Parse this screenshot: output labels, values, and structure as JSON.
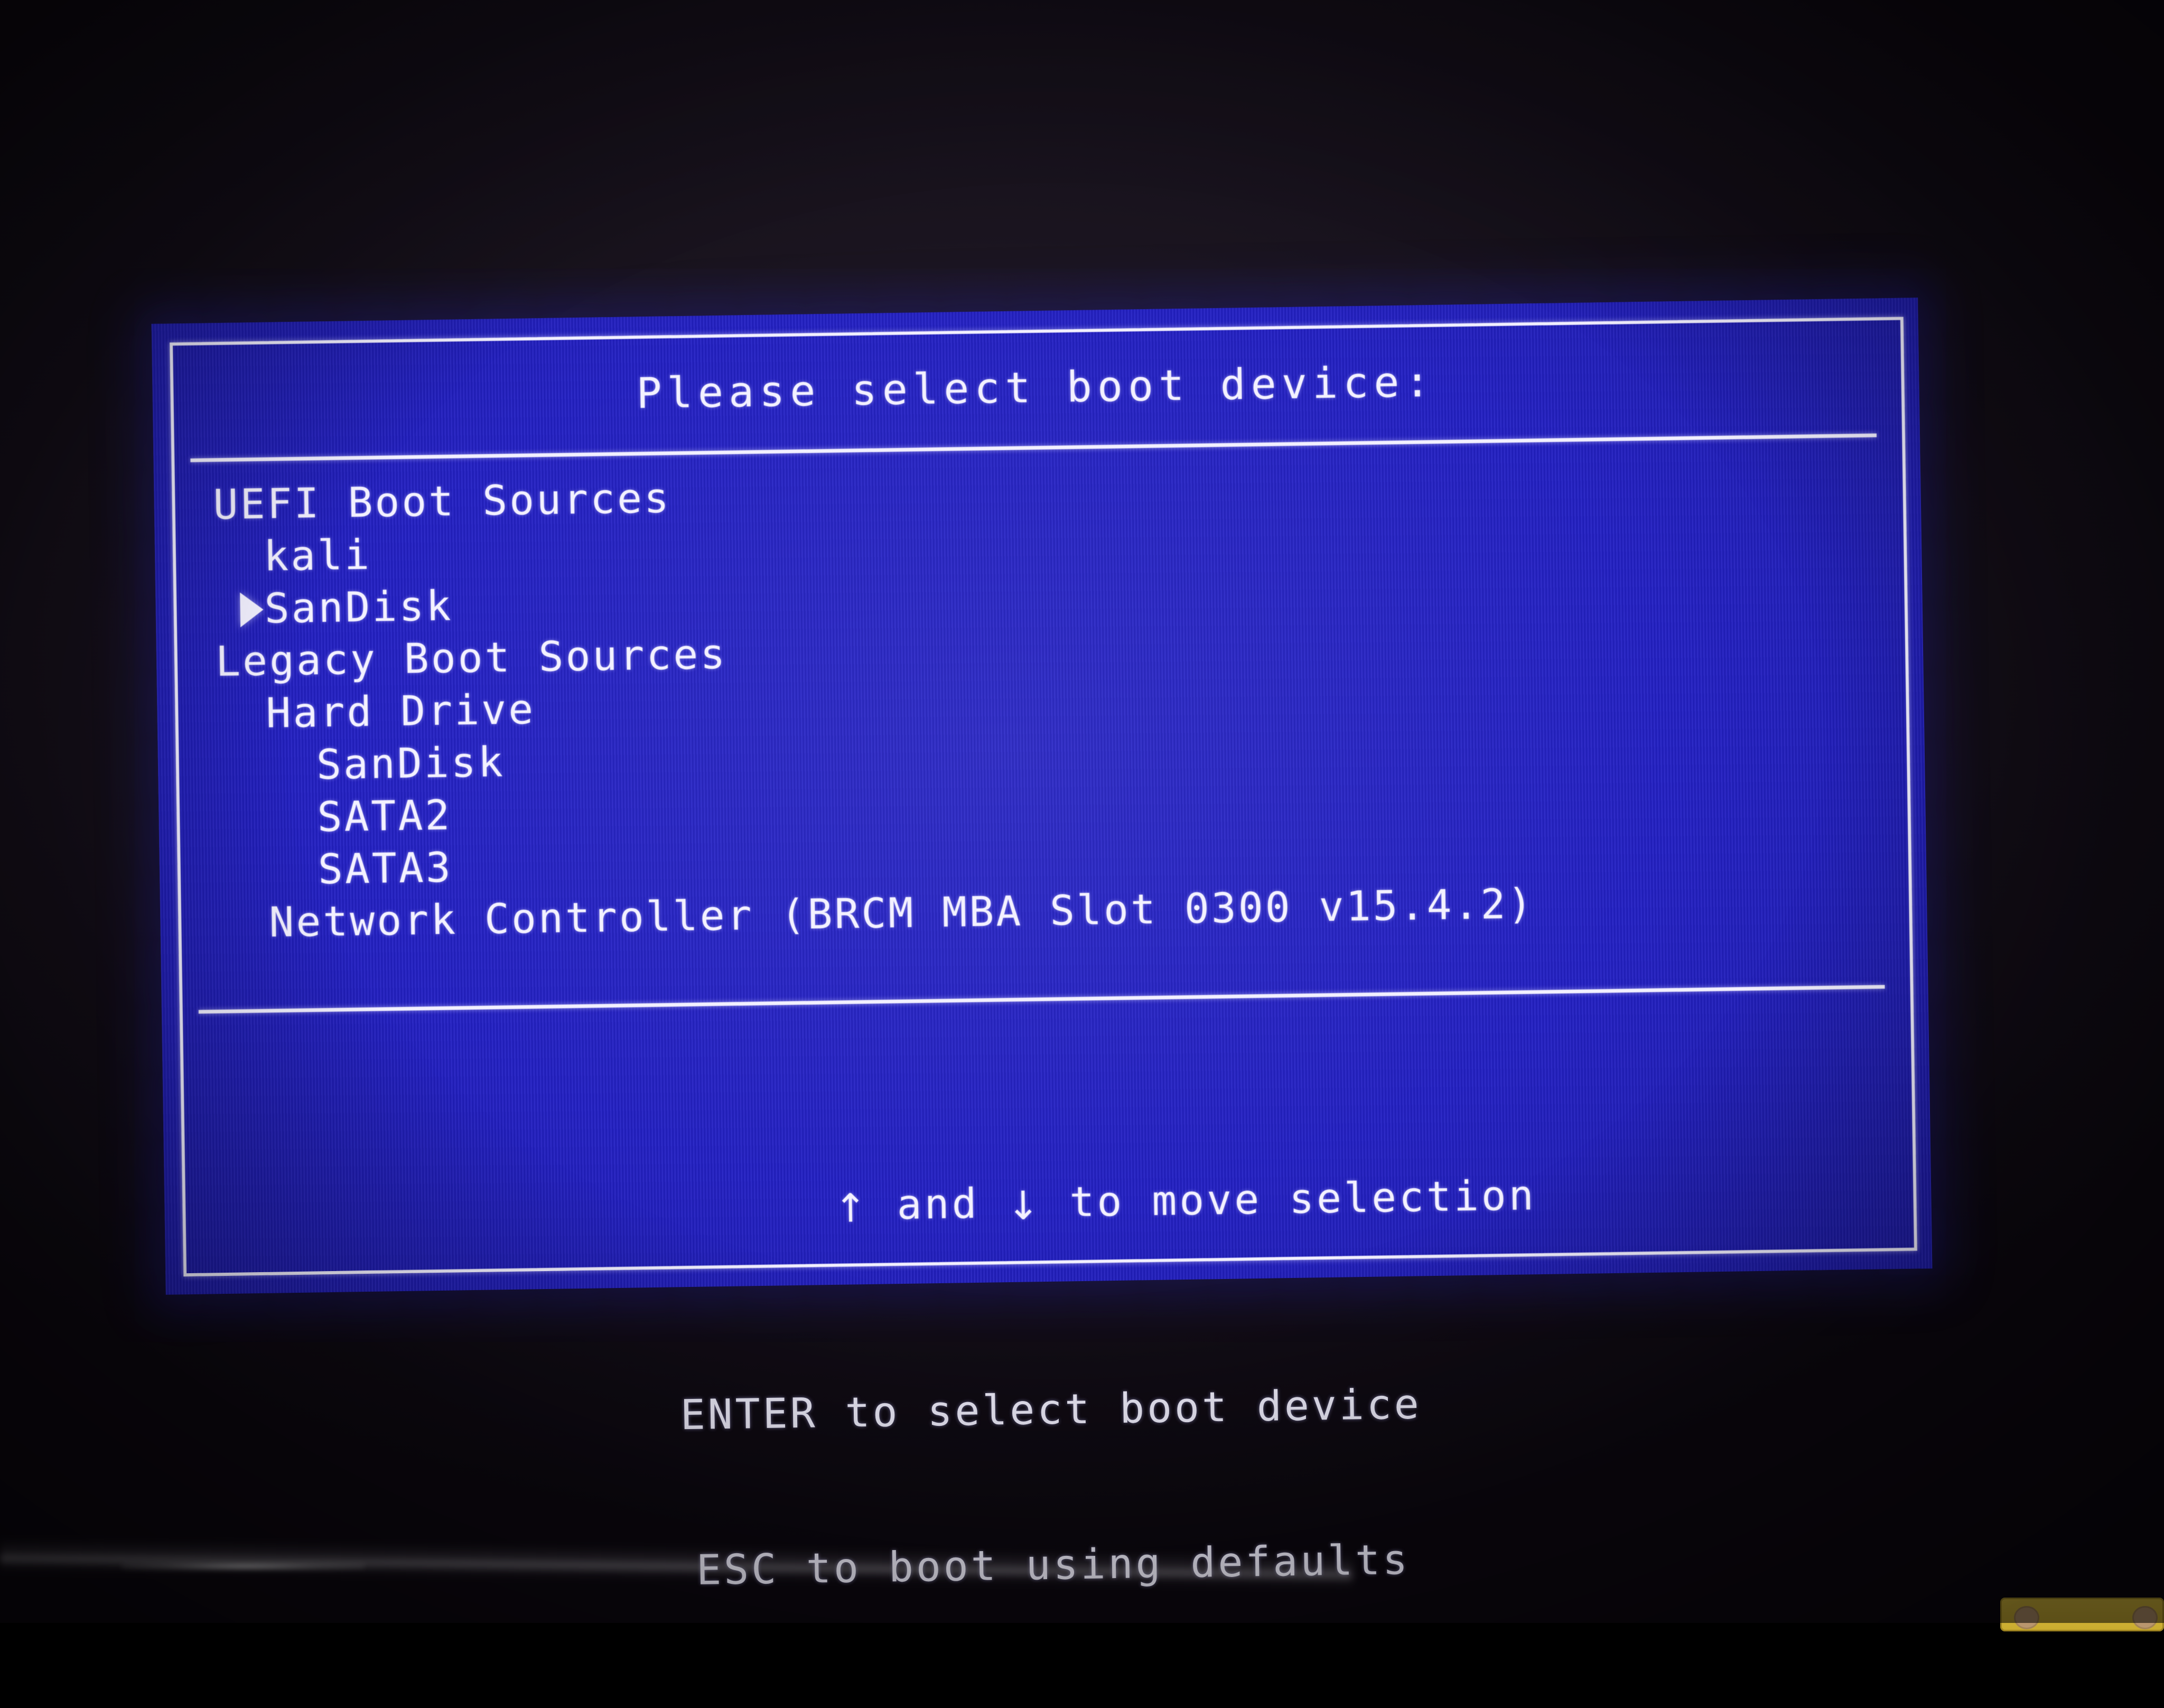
{
  "screen": {
    "background_color": "#2320c6",
    "text_color": "#f3f1ff",
    "title": "Please select boot device:"
  },
  "boot_list": [
    {
      "label": "UEFI Boot Sources",
      "indent": 0,
      "selected": false
    },
    {
      "label": "kali",
      "indent": 1,
      "selected": false
    },
    {
      "label": "SanDisk",
      "indent": 1,
      "selected": true
    },
    {
      "label": "Legacy Boot Sources",
      "indent": 0,
      "selected": false
    },
    {
      "label": "Hard Drive",
      "indent": 1,
      "selected": false
    },
    {
      "label": "SanDisk",
      "indent": 2,
      "selected": false
    },
    {
      "label": "SATA2",
      "indent": 2,
      "selected": false
    },
    {
      "label": "SATA3",
      "indent": 2,
      "selected": false
    },
    {
      "label": "Network Controller (BRCM MBA Slot 0300 v15.4.2)",
      "indent": 1,
      "selected": false
    }
  ],
  "footer": {
    "line1_prefix": "",
    "up_arrow": "↑",
    "line1_middle": " and ",
    "down_arrow": "↓",
    "line1_suffix": " to move selection",
    "line2": "ENTER to select boot device",
    "line3": "ESC to boot using defaults"
  },
  "selection_marker": "▶",
  "environment": {
    "room_background_color": "#17111a",
    "label_color": "#d8bb3e"
  }
}
